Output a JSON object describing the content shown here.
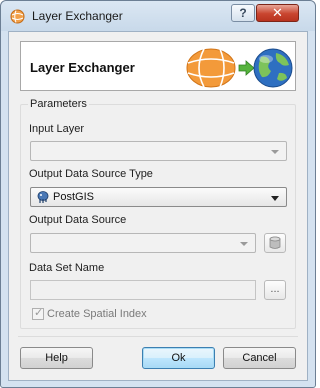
{
  "window": {
    "title": "Layer Exchanger",
    "help_glyph": "?",
    "close_glyph": "✕"
  },
  "header": {
    "title": "Layer Exchanger"
  },
  "parameters": {
    "legend": "Parameters",
    "input_layer": {
      "label": "Input Layer",
      "value": ""
    },
    "output_type": {
      "label": "Output Data Source Type",
      "value": "PostGIS"
    },
    "output_source": {
      "label": "Output Data Source",
      "value": ""
    },
    "dataset_name": {
      "label": "Data Set Name",
      "value": "",
      "browse_label": "..."
    },
    "spatial_index": {
      "label": "Create Spatial Index",
      "checked": true,
      "enabled": false
    }
  },
  "buttons": {
    "help": "Help",
    "ok": "Ok",
    "cancel": "Cancel"
  }
}
